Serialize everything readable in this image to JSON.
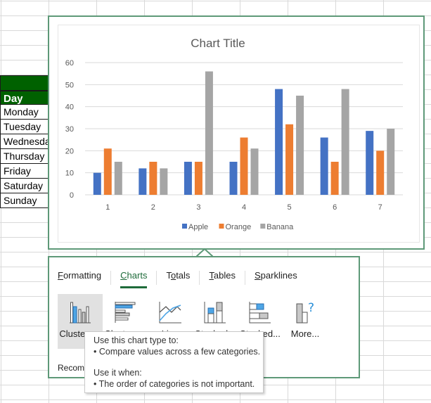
{
  "sheet": {
    "table_header": "Day",
    "days": [
      "Monday",
      "Tuesday",
      "Wednesday",
      "Thursday",
      "Friday",
      "Saturday",
      "Sunday"
    ]
  },
  "colors": {
    "accent_green": "#1e6b3a",
    "table_header_green": "#006100",
    "apple": "#4472c4",
    "orange": "#ed7d31",
    "banana": "#a5a5a5"
  },
  "chart_data": {
    "type": "bar",
    "title": "Chart Title",
    "categories": [
      "1",
      "2",
      "3",
      "4",
      "5",
      "6",
      "7"
    ],
    "series": [
      {
        "name": "Apple",
        "values": [
          10,
          12,
          15,
          15,
          48,
          26,
          29
        ]
      },
      {
        "name": "Orange",
        "values": [
          21,
          15,
          15,
          26,
          32,
          15,
          20
        ]
      },
      {
        "name": "Banana",
        "values": [
          15,
          12,
          56,
          21,
          45,
          48,
          30
        ]
      }
    ],
    "xlabel": "",
    "ylabel": "",
    "ylim": [
      0,
      60
    ],
    "yticks": [
      0,
      10,
      20,
      30,
      40,
      50,
      60
    ],
    "grid": true,
    "legend": "bottom"
  },
  "quick_analysis": {
    "tabs": [
      {
        "label": "Formatting",
        "mnemonic": "F",
        "rest": "ormatting",
        "active": false
      },
      {
        "label": "Charts",
        "mnemonic": "C",
        "rest": "harts",
        "active": true
      },
      {
        "label": "Totals",
        "pre": "T",
        "mnemonic": "o",
        "rest": "tals",
        "active": false
      },
      {
        "label": "Tables",
        "mnemonic": "T",
        "rest": "ables",
        "active": false
      },
      {
        "label": "Sparklines",
        "mnemonic": "S",
        "rest": "parklines",
        "active": false
      }
    ],
    "items": [
      {
        "label": "Clustere...",
        "icon": "clustered-column-icon",
        "selected": true
      },
      {
        "label": "Clustere...",
        "icon": "clustered-bar-icon",
        "selected": false
      },
      {
        "label": "Line",
        "icon": "line-chart-icon",
        "selected": false
      },
      {
        "label": "Stacked...",
        "icon": "stacked-column-icon",
        "selected": false
      },
      {
        "label": "Stacked...",
        "icon": "stacked-bar-icon",
        "selected": false
      },
      {
        "label": "More...",
        "icon": "more-charts-icon",
        "selected": false
      }
    ],
    "footer": "Recommended Charts help you visualize data."
  },
  "tooltip": {
    "heading1": "Use this chart type to:",
    "bullet1": "• Compare values across a few categories.",
    "heading2": "Use it when:",
    "bullet2": "• The order of categories is not important."
  }
}
